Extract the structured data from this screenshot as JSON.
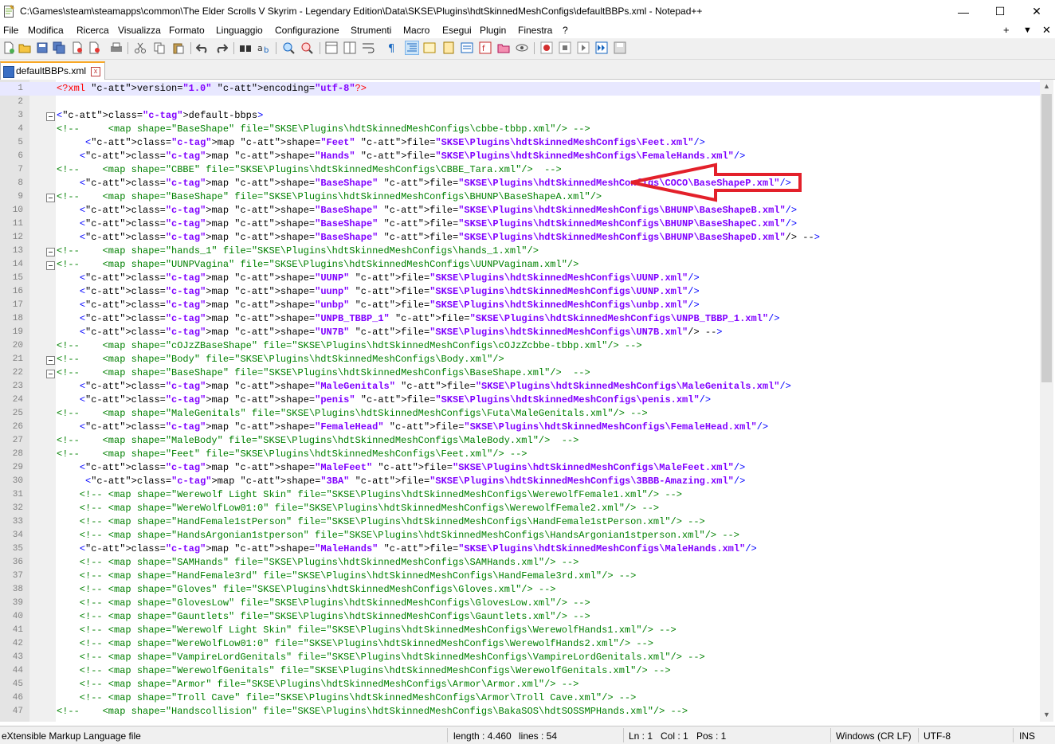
{
  "window": {
    "title": "C:\\Games\\steam\\steamapps\\common\\The Elder Scrolls V Skyrim - Legendary Edition\\Data\\SKSE\\Plugins\\hdtSkinnedMeshConfigs\\defaultBBPs.xml - Notepad++",
    "minimize": "—",
    "maximize": "☐",
    "close": "✕"
  },
  "menu": {
    "items": [
      "File",
      "Modifica",
      "Ricerca",
      "Visualizza",
      "Formato",
      "Linguaggio",
      "Configurazione",
      "Strumenti",
      "Macro",
      "Esegui",
      "Plugin",
      "Finestra",
      "?"
    ],
    "plus": "+",
    "dropdown": "▼",
    "close": "✕"
  },
  "tab": {
    "label": "defaultBBPs.xml",
    "close": "x"
  },
  "lines": [
    "<?xml version=\"1.0\" encoding=\"utf-8\"?>",
    "",
    "<default-bbps>",
    "<!--     <map shape=\"BaseShape\" file=\"SKSE\\Plugins\\hdtSkinnedMeshConfigs\\cbbe-tbbp.xml\"/> -->",
    "     <map shape=\"Feet\" file=\"SKSE\\Plugins\\hdtSkinnedMeshConfigs\\Feet.xml\"/>",
    "    <map shape=\"Hands\" file=\"SKSE\\Plugins\\hdtSkinnedMeshConfigs\\FemaleHands.xml\"/>",
    "<!--    <map shape=\"CBBE\" file=\"SKSE\\Plugins\\hdtSkinnedMeshConfigs\\CBBE_Tara.xml\"/>  -->",
    "    <map shape=\"BaseShape\" file=\"SKSE\\Plugins\\hdtSkinnedMeshConfigs\\COCO\\BaseShapeP.xml\"/>",
    "<!--    <map shape=\"BaseShape\" file=\"SKSE\\Plugins\\hdtSkinnedMeshConfigs\\BHUNP\\BaseShapeA.xml\"/>",
    "    <map shape=\"BaseShape\" file=\"SKSE\\Plugins\\hdtSkinnedMeshConfigs\\BHUNP\\BaseShapeB.xml\"/>",
    "    <map shape=\"BaseShape\" file=\"SKSE\\Plugins\\hdtSkinnedMeshConfigs\\BHUNP\\BaseShapeC.xml\"/>",
    "    <map shape=\"BaseShape\" file=\"SKSE\\Plugins\\hdtSkinnedMeshConfigs\\BHUNP\\BaseShapeD.xml\"/> -->",
    "<!--    <map shape=\"hands_1\" file=\"SKSE\\Plugins\\hdtSkinnedMeshConfigs\\hands_1.xml\"/>",
    "<!--    <map shape=\"UUNPVagina\" file=\"SKSE\\Plugins\\hdtSkinnedMeshConfigs\\UUNPVaginam.xml\"/>",
    "    <map shape=\"UUNP\" file=\"SKSE\\Plugins\\hdtSkinnedMeshConfigs\\UUNP.xml\"/>",
    "    <map shape=\"uunp\" file=\"SKSE\\Plugins\\hdtSkinnedMeshConfigs\\UUNP.xml\"/>",
    "    <map shape=\"unbp\" file=\"SKSE\\Plugins\\hdtSkinnedMeshConfigs\\unbp.xml\"/>",
    "    <map shape=\"UNPB_TBBP_1\" file=\"SKSE\\Plugins\\hdtSkinnedMeshConfigs\\UNPB_TBBP_1.xml\"/>",
    "    <map shape=\"UN7B\" file=\"SKSE\\Plugins\\hdtSkinnedMeshConfigs\\UN7B.xml\"/> -->",
    "<!--    <map shape=\"cOJzZBaseShape\" file=\"SKSE\\Plugins\\hdtSkinnedMeshConfigs\\cOJzZcbbe-tbbp.xml\"/> -->",
    "<!--    <map shape=\"Body\" file=\"SKSE\\Plugins\\hdtSkinnedMeshConfigs\\Body.xml\"/>",
    "<!--    <map shape=\"BaseShape\" file=\"SKSE\\Plugins\\hdtSkinnedMeshConfigs\\BaseShape.xml\"/>  -->",
    "    <map shape=\"MaleGenitals\" file=\"SKSE\\Plugins\\hdtSkinnedMeshConfigs\\MaleGenitals.xml\"/>",
    "    <map shape=\"penis\" file=\"SKSE\\Plugins\\hdtSkinnedMeshConfigs\\penis.xml\"/>",
    "<!--    <map shape=\"MaleGenitals\" file=\"SKSE\\Plugins\\hdtSkinnedMeshConfigs\\Futa\\MaleGenitals.xml\"/> -->",
    "    <map shape=\"FemaleHead\" file=\"SKSE\\Plugins\\hdtSkinnedMeshConfigs\\FemaleHead.xml\"/>",
    "<!--    <map shape=\"MaleBody\" file=\"SKSE\\Plugins\\hdtSkinnedMeshConfigs\\MaleBody.xml\"/>  -->",
    "<!--    <map shape=\"Feet\" file=\"SKSE\\Plugins\\hdtSkinnedMeshConfigs\\Feet.xml\"/> -->",
    "    <map shape=\"MaleFeet\" file=\"SKSE\\Plugins\\hdtSkinnedMeshConfigs\\MaleFeet.xml\"/>",
    "     <map shape=\"3BA\" file=\"SKSE\\Plugins\\hdtSkinnedMeshConfigs\\3BBB-Amazing.xml\"/>",
    "    <!-- <map shape=\"Werewolf Light Skin\" file=\"SKSE\\Plugins\\hdtSkinnedMeshConfigs\\WerewolfFemale1.xml\"/> -->",
    "    <!-- <map shape=\"WereWolfLow01:0\" file=\"SKSE\\Plugins\\hdtSkinnedMeshConfigs\\WerewolfFemale2.xml\"/> -->",
    "    <!-- <map shape=\"HandFemale1stPerson\" file=\"SKSE\\Plugins\\hdtSkinnedMeshConfigs\\HandFemale1stPerson.xml\"/> -->",
    "    <!-- <map shape=\"HandsArgonian1stperson\" file=\"SKSE\\Plugins\\hdtSkinnedMeshConfigs\\HandsArgonian1stperson.xml\"/> -->",
    "    <map shape=\"MaleHands\" file=\"SKSE\\Plugins\\hdtSkinnedMeshConfigs\\MaleHands.xml\"/>",
    "    <!-- <map shape=\"SAMHands\" file=\"SKSE\\Plugins\\hdtSkinnedMeshConfigs\\SAMHands.xml\"/> -->",
    "    <!-- <map shape=\"HandFemale3rd\" file=\"SKSE\\Plugins\\hdtSkinnedMeshConfigs\\HandFemale3rd.xml\"/> -->",
    "    <!-- <map shape=\"Gloves\" file=\"SKSE\\Plugins\\hdtSkinnedMeshConfigs\\Gloves.xml\"/> -->",
    "    <!-- <map shape=\"GlovesLow\" file=\"SKSE\\Plugins\\hdtSkinnedMeshConfigs\\GlovesLow.xml\"/> -->",
    "    <!-- <map shape=\"Gauntlets\" file=\"SKSE\\Plugins\\hdtSkinnedMeshConfigs\\Gauntlets.xml\"/> -->",
    "    <!-- <map shape=\"Werewolf Light Skin\" file=\"SKSE\\Plugins\\hdtSkinnedMeshConfigs\\WerewolfHands1.xml\"/> -->",
    "    <!-- <map shape=\"WereWolfLow01:0\" file=\"SKSE\\Plugins\\hdtSkinnedMeshConfigs\\WerewolfHands2.xml\"/> -->",
    "    <!-- <map shape=\"VampireLordGenitals\" file=\"SKSE\\Plugins\\hdtSkinnedMeshConfigs\\VampireLordGenitals.xml\"/> -->",
    "    <!-- <map shape=\"WerewolfGenitals\" file=\"SKSE\\Plugins\\hdtSkinnedMeshConfigs\\WerewolfGenitals.xml\"/> -->",
    "    <!-- <map shape=\"Armor\" file=\"SKSE\\Plugins\\hdtSkinnedMeshConfigs\\Armor\\Armor.xml\"/> -->",
    "    <!-- <map shape=\"Troll Cave\" file=\"SKSE\\Plugins\\hdtSkinnedMeshConfigs\\Armor\\Troll Cave.xml\"/> -->",
    "<!--    <map shape=\"Handscollision\" file=\"SKSE\\Plugins\\hdtSkinnedMeshConfigs\\BakaSOS\\hdtSOSSMPHands.xml\"/> -->"
  ],
  "status": {
    "filetype": "eXtensible Markup Language file",
    "length": "length : 4.460",
    "lines": "lines : 54",
    "ln": "Ln : 1",
    "col": "Col : 1",
    "pos": "Pos : 1",
    "eol": "Windows (CR LF)",
    "encoding": "UTF-8",
    "mode": "INS"
  },
  "colors": {
    "comment": "#008000",
    "tag": "#0000ff",
    "attribute": "#ff0000",
    "value": "#8000ff",
    "annotation_arrow": "#e3202a"
  }
}
